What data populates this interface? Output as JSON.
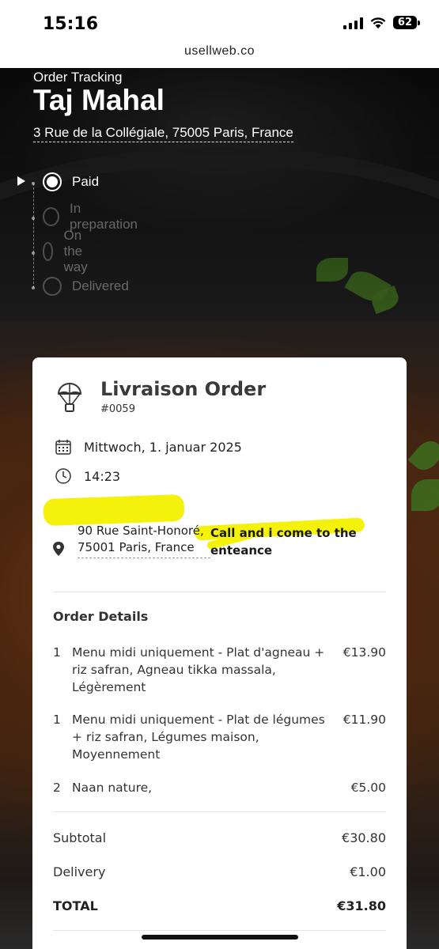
{
  "status_bar": {
    "time": "15:16",
    "battery": "62"
  },
  "browser": {
    "url": "usellweb.co"
  },
  "header": {
    "subtitle": "Order Tracking",
    "restaurant_name": "Taj Mahal",
    "address": "3 Rue de la Collégiale, 75005 Paris, France"
  },
  "timeline": {
    "steps": [
      {
        "label": "Paid",
        "active": true
      },
      {
        "label": "In preparation",
        "active": false
      },
      {
        "label": "On the way",
        "active": false
      },
      {
        "label": "Delivered",
        "active": false
      }
    ]
  },
  "order": {
    "title": "Livraison Order",
    "number": "#0059",
    "date": "Mittwoch, 1. januar 2025",
    "time": "14:23",
    "delivery_address": "90 Rue Saint-Honoré, 75001 Paris, France",
    "note": "Call and i come to the enteance",
    "details_title": "Order Details",
    "items": [
      {
        "qty": "1",
        "name": "Menu midi uniquement - Plat d'agneau + riz safran, Agneau tikka massala, Légèrement",
        "price": "€13.90"
      },
      {
        "qty": "1",
        "name": "Menu midi uniquement - Plat de légumes + riz safran, Légumes maison, Moyennement",
        "price": "€11.90"
      },
      {
        "qty": "2",
        "name": "Naan nature,",
        "price": "€5.00"
      }
    ],
    "subtotal_label": "Subtotal",
    "subtotal": "€30.80",
    "delivery_label": "Delivery",
    "delivery": "€1.00",
    "total_label": "TOTAL",
    "total": "€31.80"
  },
  "colors": {
    "highlight": "#f4f20a",
    "card_bg": "#ffffff",
    "text_dark": "#333333"
  }
}
